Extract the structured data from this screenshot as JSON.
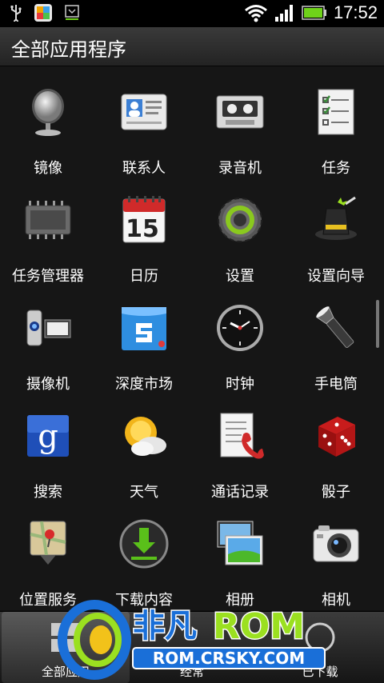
{
  "status_bar": {
    "time": "17:52",
    "icons": [
      "usb-icon",
      "color-app-icon",
      "download-notification-icon",
      "wifi-icon",
      "signal-icon",
      "battery-icon"
    ]
  },
  "header": {
    "title": "全部应用程序"
  },
  "apps": [
    {
      "label": "镜像",
      "icon": "mirror-icon"
    },
    {
      "label": "联系人",
      "icon": "contacts-icon"
    },
    {
      "label": "录音机",
      "icon": "recorder-icon"
    },
    {
      "label": "任务",
      "icon": "tasks-icon"
    },
    {
      "label": "任务管理器",
      "icon": "task-manager-icon"
    },
    {
      "label": "日历",
      "icon": "calendar-icon",
      "day": "15"
    },
    {
      "label": "设置",
      "icon": "settings-icon"
    },
    {
      "label": "设置向导",
      "icon": "setup-wizard-icon"
    },
    {
      "label": "摄像机",
      "icon": "camcorder-icon"
    },
    {
      "label": "深度市场",
      "icon": "market-icon"
    },
    {
      "label": "时钟",
      "icon": "clock-icon"
    },
    {
      "label": "手电筒",
      "icon": "flashlight-icon"
    },
    {
      "label": "搜索",
      "icon": "search-icon",
      "glyph": "g"
    },
    {
      "label": "天气",
      "icon": "weather-icon"
    },
    {
      "label": "通话记录",
      "icon": "call-log-icon"
    },
    {
      "label": "骰子",
      "icon": "dice-icon"
    },
    {
      "label": "位置服务",
      "icon": "location-icon"
    },
    {
      "label": "下载内容",
      "icon": "downloads-icon"
    },
    {
      "label": "相册",
      "icon": "gallery-icon"
    },
    {
      "label": "相机",
      "icon": "camera-icon"
    }
  ],
  "bottom_tabs": [
    {
      "label": "全部应用",
      "active": true
    },
    {
      "label": "经常"
    },
    {
      "label": "已下载"
    }
  ],
  "watermark": {
    "brand": "非凡",
    "rom": "ROM",
    "url": "ROM.CRSKY.COM"
  },
  "colors": {
    "background": "#161616",
    "status_bar": "#000000",
    "battery": "#6fd21a",
    "watermark_blue": "#1a6fd8",
    "watermark_green": "#9be020"
  }
}
